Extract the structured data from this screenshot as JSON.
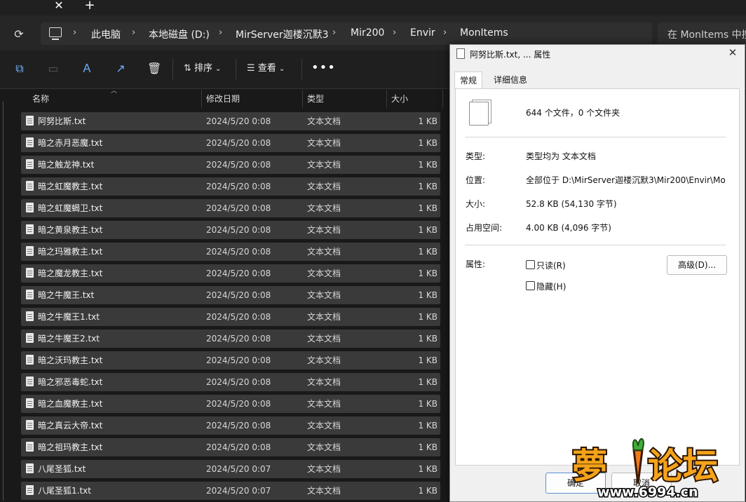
{
  "tabs": {
    "close_glyph": "✕",
    "new_glyph": "+"
  },
  "address": {
    "crumbs": [
      "此电脑",
      "本地磁盘 (D:)",
      "MirServer迦楼沉默3",
      "Mir200",
      "Envir",
      "MonItems"
    ],
    "separator": "›",
    "search_placeholder": "在 MonItems 中搜"
  },
  "toolbar": {
    "sort_label": "排序",
    "view_label": "查看",
    "more_glyph": "•••",
    "caret": "⌄"
  },
  "columns": {
    "name": "名称",
    "date": "修改日期",
    "type": "类型",
    "size": "大小"
  },
  "files": [
    {
      "name": "阿努比斯.txt",
      "date": "2024/5/20 0:08",
      "type": "文本文档",
      "size": "1 KB"
    },
    {
      "name": "暗之赤月恶魔.txt",
      "date": "2024/5/20 0:08",
      "type": "文本文档",
      "size": "1 KB"
    },
    {
      "name": "暗之触龙神.txt",
      "date": "2024/5/20 0:08",
      "type": "文本文档",
      "size": "1 KB"
    },
    {
      "name": "暗之虹魔教主.txt",
      "date": "2024/5/20 0:08",
      "type": "文本文档",
      "size": "1 KB"
    },
    {
      "name": "暗之虹魔蝎卫.txt",
      "date": "2024/5/20 0:08",
      "type": "文本文档",
      "size": "1 KB"
    },
    {
      "name": "暗之黄泉教主.txt",
      "date": "2024/5/20 0:08",
      "type": "文本文档",
      "size": "1 KB"
    },
    {
      "name": "暗之玛雅教主.txt",
      "date": "2024/5/20 0:08",
      "type": "文本文档",
      "size": "1 KB"
    },
    {
      "name": "暗之魔龙教主.txt",
      "date": "2024/5/20 0:08",
      "type": "文本文档",
      "size": "1 KB"
    },
    {
      "name": "暗之牛魔王.txt",
      "date": "2024/5/20 0:08",
      "type": "文本文档",
      "size": "1 KB"
    },
    {
      "name": "暗之牛魔王1.txt",
      "date": "2024/5/20 0:08",
      "type": "文本文档",
      "size": "1 KB"
    },
    {
      "name": "暗之牛魔王2.txt",
      "date": "2024/5/20 0:08",
      "type": "文本文档",
      "size": "1 KB"
    },
    {
      "name": "暗之沃玛教主.txt",
      "date": "2024/5/20 0:08",
      "type": "文本文档",
      "size": "1 KB"
    },
    {
      "name": "暗之邪恶毒蛇.txt",
      "date": "2024/5/20 0:08",
      "type": "文本文档",
      "size": "1 KB"
    },
    {
      "name": "暗之血魔教主.txt",
      "date": "2024/5/20 0:08",
      "type": "文本文档",
      "size": "1 KB"
    },
    {
      "name": "暗之真云大帝.txt",
      "date": "2024/5/20 0:08",
      "type": "文本文档",
      "size": "1 KB"
    },
    {
      "name": "暗之祖玛教主.txt",
      "date": "2024/5/20 0:08",
      "type": "文本文档",
      "size": "1 KB"
    },
    {
      "name": "八尾圣狐.txt",
      "date": "2024/5/20 0:07",
      "type": "文本文档",
      "size": "1 KB"
    },
    {
      "name": "八尾圣狐1.txt",
      "date": "2024/5/20 0:07",
      "type": "文本文档",
      "size": "1 KB"
    }
  ],
  "dialog": {
    "title": "阿努比斯.txt, ... 属性",
    "close_glyph": "✕",
    "tabs": [
      "常规",
      "详细信息"
    ],
    "summary": "644 个文件，0 个文件夹",
    "type_label": "类型:",
    "type_value": "类型均为 文本文档",
    "location_label": "位置:",
    "location_value": "全部位于 D:\\MirServer迦楼沉默3\\Mir200\\Envir\\Mo",
    "size_label": "大小:",
    "size_value": "52.8 KB (54,130 字节)",
    "disk_label": "占用空间:",
    "disk_value": "4.00 KB (4,096 字节)",
    "attr_label": "属性:",
    "readonly_label": "只读(R)",
    "hidden_label": "隐藏(H)",
    "advanced_label": "高级(D)...",
    "ok_label": "确定",
    "cancel_label": "取消"
  },
  "watermark": {
    "text": "梦小论坛",
    "url": "www.6994.cn"
  }
}
